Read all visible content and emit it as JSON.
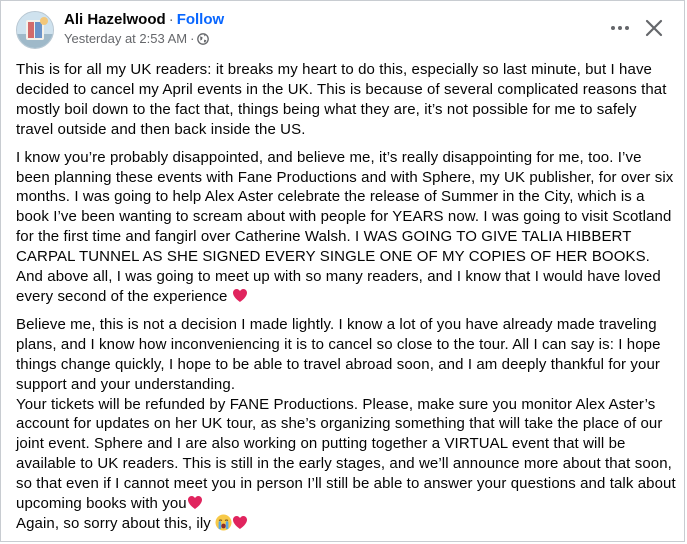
{
  "post": {
    "author": "Ali Hazelwood",
    "follow_label": "Follow",
    "separator": "·",
    "timestamp": "Yesterday at 2:53 AM",
    "privacy_icon": "globe-icon",
    "more_icon": "more-horizontal-icon",
    "close_icon": "close-icon",
    "paragraphs": [
      "This is for all my UK readers: it breaks my heart to do this, especially so last minute, but I have decided to cancel my April events in the UK. This is because of several complicated reasons that mostly boil down to the fact that, things being what they are, it’s not possible for me to safely travel outside and then back inside the US.",
      "I know you’re probably disappointed, and believe me, it’s really disappointing for me, too. I’ve been planning these events with Fane Productions and with Sphere, my UK publisher, for over six months. I was going to help Alex Aster celebrate the release of Summer in the City, which is a book I’ve been wanting to scream about with people for YEARS now. I was going to visit Scotland for the first time and fangirl over Catherine Walsh. I WAS GOING TO GIVE TALIA HIBBERT CARPAL TUNNEL AS SHE SIGNED EVERY SINGLE ONE OF MY COPIES OF HER BOOKS. And above all, I was going to meet up with so many readers, and I know that I would have loved every second of the experience",
      "Believe me, this is not a decision I made lightly. I know a lot of you have already made traveling plans, and I know how inconveniencing it is to cancel so close to the tour. All I can say is: I hope things change quickly, I hope to be able to travel abroad soon, and I am deeply thankful for your support and your understanding.",
      "Your tickets will be refunded by FANE Productions. Please, make sure you monitor Alex Aster’s account for updates on her UK tour, as she’s organizing something that will take the place of our joint event. Sphere and I are also working on putting together a VIRTUAL event that will be available to UK readers. This is still in the early stages, and we’ll announce more about that soon, so that even if I cannot meet you in person I’ll still be able to answer your questions and talk about upcoming books with you",
      "Again, so sorry about this, ily"
    ],
    "colors": {
      "text": "#050505",
      "secondary": "#65676b",
      "link": "#0866ff",
      "heart": "#e0245e"
    }
  }
}
